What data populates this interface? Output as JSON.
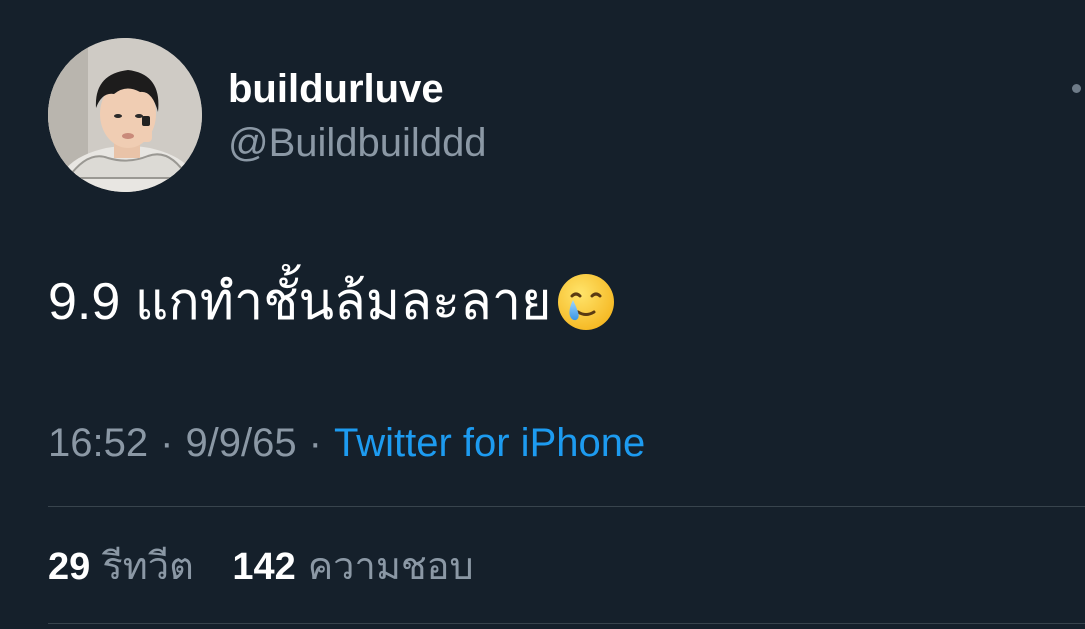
{
  "author": {
    "display_name": "buildurluve",
    "handle": "@Buildbuilddd"
  },
  "tweet": {
    "text": "9.9 แกทำชั้นล้มละลาย",
    "emoji": "smiling-face-with-tear"
  },
  "meta": {
    "time": "16:52",
    "separator": "·",
    "date": "9/9/65",
    "source": "Twitter for iPhone"
  },
  "stats": {
    "retweets_count": "29",
    "retweets_label": "รีทวีต",
    "likes_count": "142",
    "likes_label": "ความชอบ"
  },
  "colors": {
    "background": "#15202b",
    "primary_text": "#ffffff",
    "secondary_text": "#8b98a5",
    "link": "#1d9bf0",
    "divider": "#38444d"
  }
}
